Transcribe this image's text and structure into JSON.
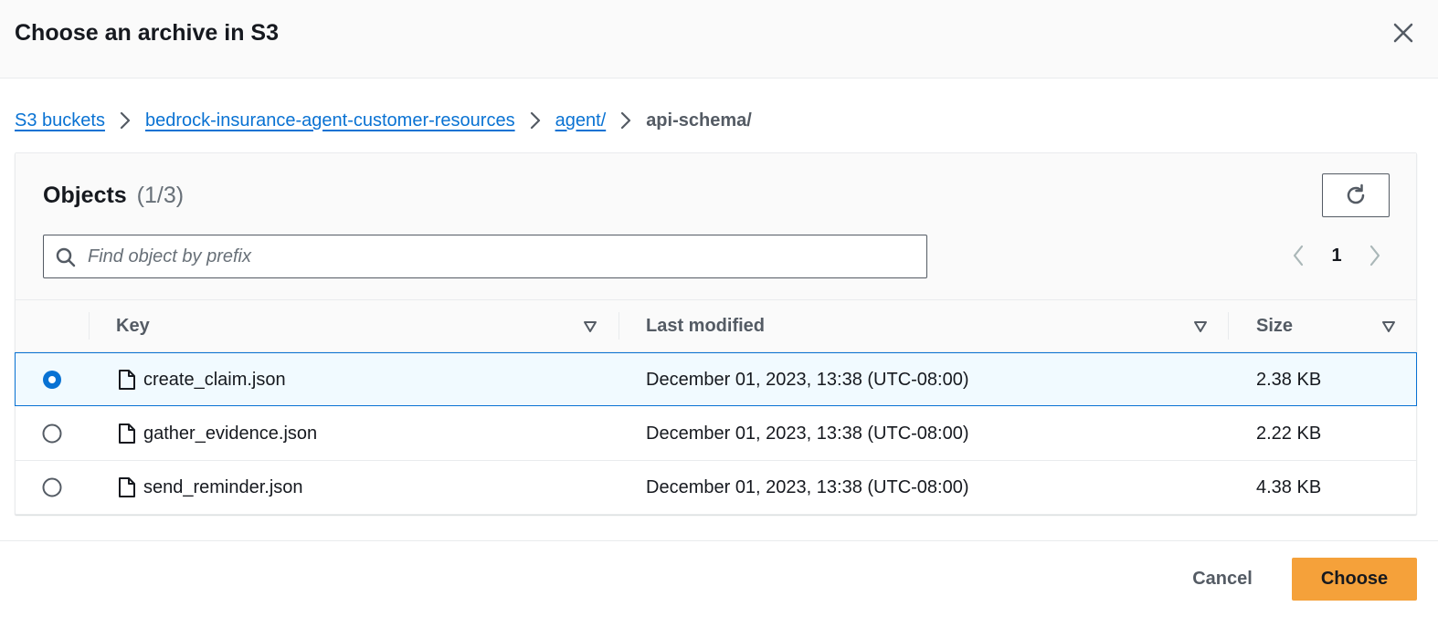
{
  "modal": {
    "title": "Choose an archive in S3"
  },
  "breadcrumb": {
    "items": [
      {
        "label": "S3 buckets"
      },
      {
        "label": "bedrock-insurance-agent-customer-resources"
      },
      {
        "label": "agent/"
      }
    ],
    "current": "api-schema/"
  },
  "objects": {
    "title": "Objects",
    "count": "(1/3)"
  },
  "search": {
    "placeholder": "Find object by prefix",
    "value": ""
  },
  "pagination": {
    "current_page": "1"
  },
  "table": {
    "columns": {
      "key": "Key",
      "last_modified": "Last modified",
      "size": "Size"
    },
    "rows": [
      {
        "key": "create_claim.json",
        "last_modified": "December 01, 2023, 13:38 (UTC-08:00)",
        "size": "2.38 KB",
        "selected": true
      },
      {
        "key": "gather_evidence.json",
        "last_modified": "December 01, 2023, 13:38 (UTC-08:00)",
        "size": "2.22 KB",
        "selected": false
      },
      {
        "key": "send_reminder.json",
        "last_modified": "December 01, 2023, 13:38 (UTC-08:00)",
        "size": "4.38 KB",
        "selected": false
      }
    ]
  },
  "footer": {
    "cancel_label": "Cancel",
    "choose_label": "Choose"
  },
  "colors": {
    "link": "#0972d3",
    "primary_button": "#f5a13a",
    "selected_row_bg": "#f1faff"
  }
}
